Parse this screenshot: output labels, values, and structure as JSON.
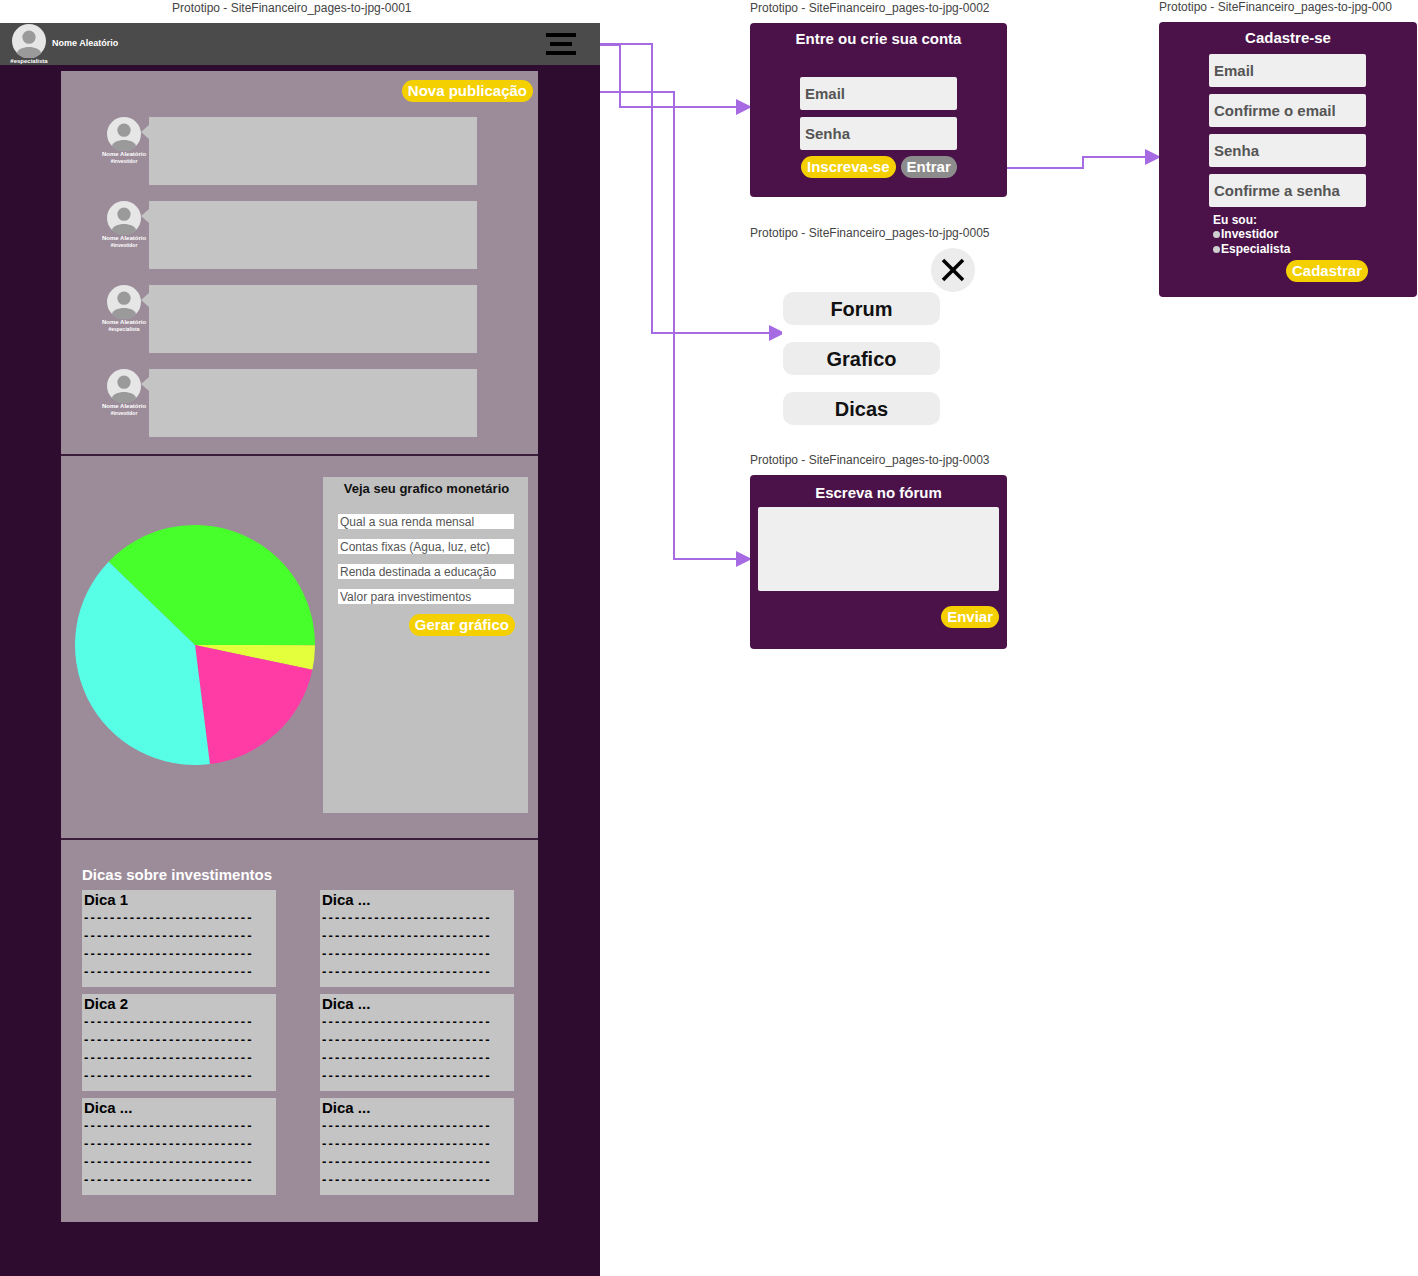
{
  "home": {
    "label": "Prototipo - SiteFinanceiro_pages-to-jpg-0001",
    "user": {
      "name": "Nome Aleatório",
      "tag": "#especialista"
    },
    "forum": {
      "new_post": "Nova publicação",
      "posts": [
        {
          "name": "Nome Aleatório",
          "tag": "#investidor"
        },
        {
          "name": "Nome Aleatório",
          "tag": "#investidor"
        },
        {
          "name": "Nome Aleatório",
          "tag": "#especialista"
        },
        {
          "name": "Nome Aleatório",
          "tag": "#investidor"
        }
      ]
    },
    "chart": {
      "title": "Veja seu grafico monetário",
      "fields": [
        "Qual a sua renda mensal",
        "Contas fixas (Agua, luz, etc)",
        "Renda destinada a educação",
        "Valor para investimentos"
      ],
      "button": "Gerar gráfico",
      "slices": [
        {
          "value": 37.8,
          "color": "#47ff2b"
        },
        {
          "value": 3.3,
          "color": "#e4ff3b"
        },
        {
          "value": 19.7,
          "color": "#ff3ca5"
        },
        {
          "value": 39.2,
          "color": "#58ffe7"
        }
      ]
    },
    "tips": {
      "title": "Dicas sobre investimentos",
      "items": [
        {
          "title": "Dica 1",
          "lines": [
            "--------------------------",
            "--------------------------",
            "--------------------------",
            "--------------------------"
          ]
        },
        {
          "title": "Dica ...",
          "lines": [
            "--------------------------",
            "--------------------------",
            "--------------------------",
            "--------------------------"
          ]
        },
        {
          "title": "Dica 2",
          "lines": [
            "--------------------------",
            "--------------------------",
            "--------------------------",
            "--------------------------"
          ]
        },
        {
          "title": "Dica ...",
          "lines": [
            "--------------------------",
            "--------------------------",
            "--------------------------",
            "--------------------------"
          ]
        },
        {
          "title": "Dica ...",
          "lines": [
            "--------------------------",
            "--------------------------",
            "--------------------------",
            "--------------------------"
          ]
        },
        {
          "title": "Dica ...",
          "lines": [
            "--------------------------",
            "--------------------------",
            "--------------------------",
            "--------------------------"
          ]
        }
      ]
    }
  },
  "login": {
    "label": "Prototipo - SiteFinanceiro_pages-to-jpg-0002",
    "title": "Entre ou crie sua conta",
    "fields": [
      "Email",
      "Senha"
    ],
    "buttons": [
      {
        "label": "Inscreva-se",
        "kind": "primary"
      },
      {
        "label": "Entrar",
        "kind": "secondary"
      }
    ]
  },
  "signup": {
    "label": "Prototipo - SiteFinanceiro_pages-to-jpg-000",
    "title": "Cadastre-se",
    "fields": [
      "Email",
      "Confirme o email",
      "Senha",
      "Confirme a senha"
    ],
    "role_label": "Eu sou:",
    "roles": [
      {
        "label": "Investidor",
        "selected": false
      },
      {
        "label": "Especialista",
        "selected": false
      }
    ],
    "button": "Cadastrar"
  },
  "menu": {
    "label": "Prototipo - SiteFinanceiro_pages-to-jpg-0005",
    "items": [
      "Forum",
      "Grafico",
      "Dicas"
    ]
  },
  "post_form": {
    "label": "Prototipo - SiteFinanceiro_pages-to-jpg-0003",
    "title": "Escreva no fórum",
    "button": "Enviar"
  }
}
